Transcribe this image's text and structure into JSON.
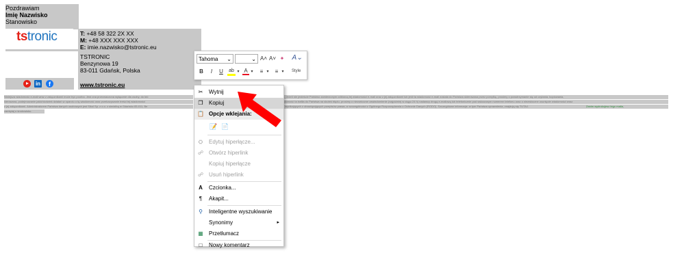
{
  "signature": {
    "greeting": "Pozdrawiam",
    "name": "Imię Nazwisko",
    "position": "Stanowisko",
    "logo": "tstronic",
    "phone_label": "T:",
    "phone": "+48 58 322 2X XX",
    "mobile_label": "M:",
    "mobile": "+48 XXX XXX XXX",
    "email_label": "E:",
    "email": "imie.nazwisko@tstronic.eu",
    "company": "TSTRONIC",
    "street": "Benzynowa 19",
    "city": "83-011 Gdańsk, Polska",
    "website": "www.tstronic.eu",
    "social_icons": [
      "youtube-icon",
      "linkedin-icon",
      "facebook-icon"
    ]
  },
  "disclaimer": {
    "lines": [
      "Niniejsza wiadomość e-mail wraz z załącznikami może być poufna. Jest ona przeznaczona wyłącznie dla osoby, do któ",
      "kierowana, podejmowanie jakichkolwiek działań w oparciu o tę wiadomość oraz przekazywanie treści tej wiadomości",
      "z jej załącznikami. Administratorem Państwa danych osobowych jest Sikol Sp. z o.o. z siedzibą w Gdańsku 83-011, Be",
      "zamiętaj o środowisku."
    ],
    "lines_right": [
      "a. Jeżeli nie jesteście Państwo zamierzonym odbiorcą tej wiadomości e-mail oraz z jej załącznikami lub jeśli ta wiadomość e-mail została do Państwa skierowana przez pomyłkę, prosimy o powstrzymanie się od czytania, kopiowania,",
      "adomość ta trafiła do Państwa na skutek błędu, prosimy o niezwłoczne zawiadomienie (najpóźniej w ciągu 24 h) nadawcy drogą e-mailową lub telefonicznie pod wskazanym numerem telefonu oraz o niezwłoczne usunięcie wiadomości wraz",
      "ń wynikających z obowiązujących przepisów prawa, w szczególności z Ogólnego Rozporządzenia o Ochronie Danych (RODO). Szczegółowe informacje, w tym Państwa uprawnienia, znajdują się TUTAJ."
    ],
    "green_text": "Zanim wydrukujesz tego maila,"
  },
  "toolbar": {
    "font": "Tahoma",
    "size": "",
    "grow_font": "A˄",
    "shrink_font": "A˅",
    "bold": "B",
    "italic": "I",
    "underline": "U",
    "font_color": "A",
    "style_label": "Style",
    "highlight_color": "#ffff00",
    "font_color_value": "#e81123"
  },
  "context_menu": {
    "items": [
      {
        "label": "Wytnij",
        "icon": "scissors-icon",
        "enabled": true
      },
      {
        "label": "Kopiuj",
        "icon": "copy-icon",
        "enabled": true,
        "highlighted": true
      },
      {
        "label": "Opcje wklejania:",
        "icon": "paste-icon",
        "header": true
      },
      {
        "label": "Edytuj hiperłącze...",
        "icon": "link-edit-icon",
        "enabled": false
      },
      {
        "label": "Otwórz hiperlink",
        "icon": "link-open-icon",
        "enabled": false
      },
      {
        "label": "Kopiuj hiperłącze",
        "icon": "",
        "enabled": false
      },
      {
        "label": "Usuń hiperlink",
        "icon": "link-remove-icon",
        "enabled": false
      },
      {
        "label": "Czcionka...",
        "icon": "font-icon",
        "enabled": true
      },
      {
        "label": "Akapit...",
        "icon": "paragraph-icon",
        "enabled": true
      },
      {
        "label": "Inteligentne wyszukiwanie",
        "icon": "search-icon",
        "enabled": true
      },
      {
        "label": "Synonimy",
        "icon": "",
        "enabled": true,
        "submenu": true
      },
      {
        "label": "Przetłumacz",
        "icon": "translate-icon",
        "enabled": true
      },
      {
        "label": "Nowy komentarz",
        "icon": "comment-icon",
        "enabled": true
      }
    ]
  },
  "colors": {
    "selection": "#c8c8c8",
    "arrow": "#ff0000",
    "logo_blue": "#1e73be",
    "logo_red": "#e2231a"
  }
}
